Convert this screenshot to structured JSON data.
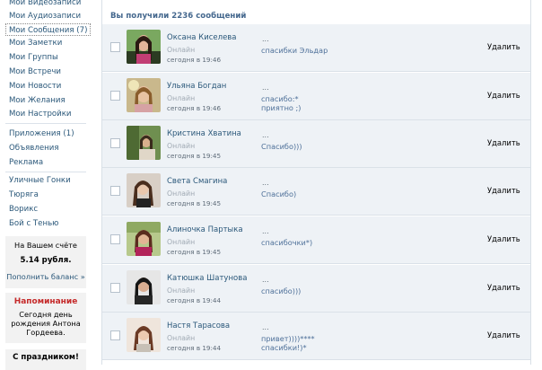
{
  "sidebar": {
    "menu": [
      {
        "label": "Мои Видеозаписи"
      },
      {
        "label": "Мои Аудиозаписи"
      },
      {
        "label": "Мои Сообщения (7)"
      },
      {
        "label": "Мои Заметки"
      },
      {
        "label": "Мои Группы"
      },
      {
        "label": "Мои Встречи"
      },
      {
        "label": "Мои Новости"
      },
      {
        "label": "Мои Желания"
      },
      {
        "label": "Мои Настройки"
      },
      {
        "label": "Приложения (1)"
      },
      {
        "label": "Объявления"
      },
      {
        "label": "Реклама"
      },
      {
        "label": "Уличные Гонки"
      },
      {
        "label": "Тюряга"
      },
      {
        "label": "Ворикс"
      },
      {
        "label": "Бой с Тенью"
      }
    ],
    "balance": {
      "heading": "На Вашем счёте",
      "amount": "5.14 рубля.",
      "topup": "Пополнить баланс »"
    },
    "reminder": {
      "heading": "Напоминание",
      "line1": "Сегодня день",
      "line2": "рождения Антона",
      "line3": "Гордеева."
    },
    "congrats": "С праздником!"
  },
  "main": {
    "title": "Вы получили 2236 сообщений",
    "ellipsis": "...",
    "delete_label": "Удалить",
    "messages": [
      {
        "sender": "Оксана Киселева",
        "status": "Онлайн",
        "date": "сегодня в 19:46",
        "text": "спасибки Эльдар",
        "text2": ""
      },
      {
        "sender": "Ульяна Богдан",
        "status": "Онлайн",
        "date": "сегодня в 19:46",
        "text": "спасибо:*",
        "text2": "приятно ;)"
      },
      {
        "sender": "Кристина Хватина",
        "status": "Онлайн",
        "date": "сегодня в 19:45",
        "text": "Спасибо)))",
        "text2": ""
      },
      {
        "sender": "Света Смагина",
        "status": "Онлайн",
        "date": "сегодня в 19:45",
        "text": "Спасибо)",
        "text2": ""
      },
      {
        "sender": "Алиночка Партыка",
        "status": "Онлайн",
        "date": "сегодня в 19:45",
        "text": "спасибочки*)",
        "text2": ""
      },
      {
        "sender": "Катюшка Шатунова",
        "status": "Онлайн",
        "date": "сегодня в 19:44",
        "text": "спасибо)))",
        "text2": ""
      },
      {
        "sender": "Настя Тарасова",
        "status": "Онлайн",
        "date": "сегодня в 19:44",
        "text": "привет))))****",
        "text2": "спасибки!)*"
      }
    ]
  }
}
